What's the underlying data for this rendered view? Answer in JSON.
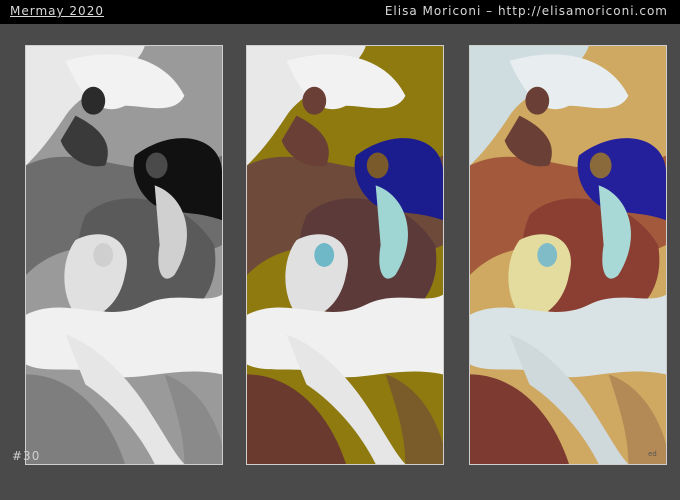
{
  "header": {
    "series_title": "Mermay 2020",
    "credit": "Elisa Moriconi – http://elisamoriconi.com"
  },
  "footer": {
    "number": "#30"
  },
  "panels": [
    {
      "stage": "grayscale"
    },
    {
      "stage": "flat color"
    },
    {
      "stage": "final render",
      "signature": "ed"
    }
  ],
  "colors": {
    "background": "#4a4a4a",
    "topbar": "#000000",
    "gray_bg": "#9a9a9a",
    "flat_bg": "#8f7a10",
    "final_bg": "#cfa861",
    "blue_hair": "#1b1c8e",
    "white_hair": "#e6e6e6",
    "blonde_hair": "#e4dc9e",
    "skin": "#6a3f36"
  }
}
